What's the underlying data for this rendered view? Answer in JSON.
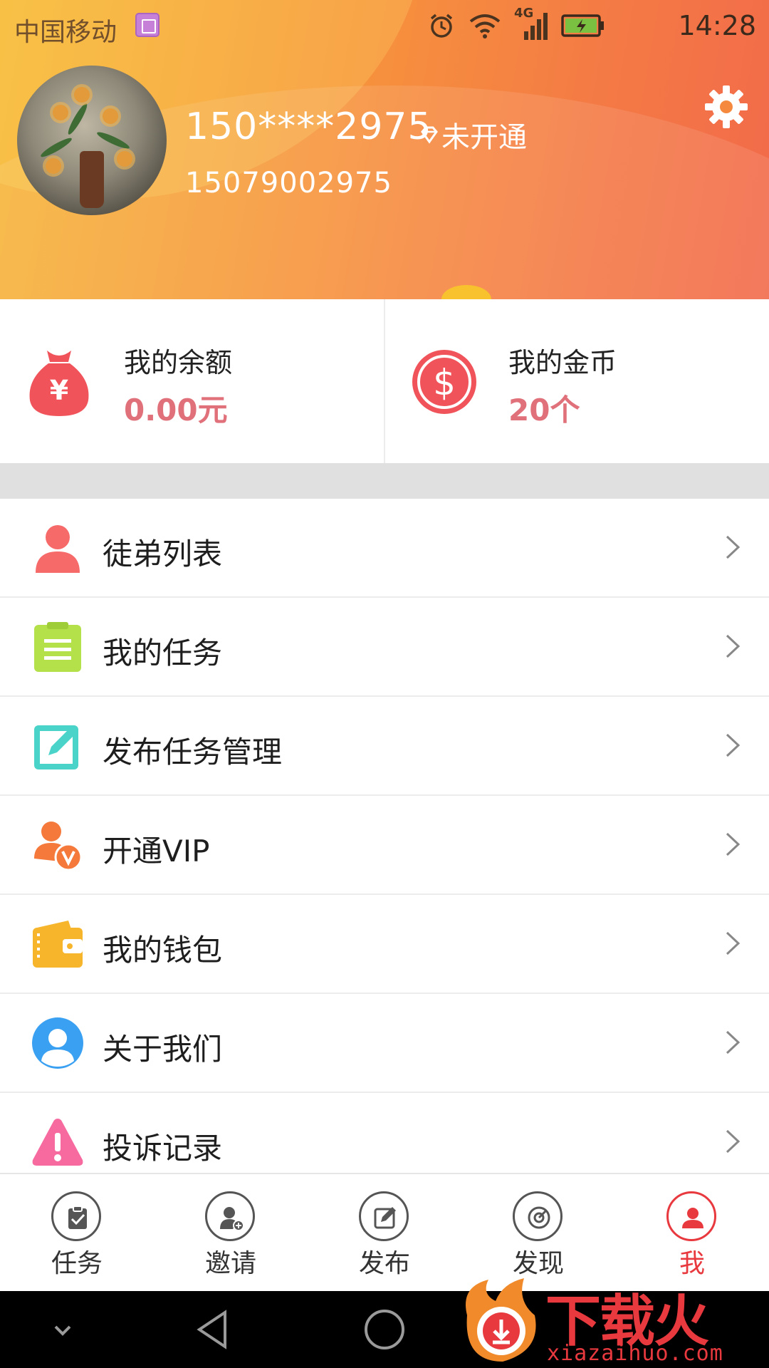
{
  "status_bar": {
    "carrier": "中国移动",
    "network": "4G",
    "time": "14:28"
  },
  "profile": {
    "display_name": "150****2975",
    "vip_status": "未开通",
    "phone": "15079002975"
  },
  "wallet": {
    "balance_label": "我的余额",
    "balance_value": "0.00元",
    "coins_label": "我的金币",
    "coins_value": "20个"
  },
  "menu": {
    "items": [
      {
        "label": "徒弟列表",
        "icon": "person-icon",
        "color": "#f76a6a"
      },
      {
        "label": "我的任务",
        "icon": "clipboard-icon",
        "color": "#b4e04a"
      },
      {
        "label": "发布任务管理",
        "icon": "edit-icon",
        "color": "#4ad4c9"
      },
      {
        "label": "开通VIP",
        "icon": "vip-user-icon",
        "color": "#f4793b"
      },
      {
        "label": "我的钱包",
        "icon": "wallet-icon",
        "color": "#f7b52c"
      },
      {
        "label": "关于我们",
        "icon": "user-circle-icon",
        "color": "#3aa0f2"
      },
      {
        "label": "投诉记录",
        "icon": "warning-icon",
        "color": "#f76aa0"
      }
    ]
  },
  "tabbar": {
    "tabs": [
      {
        "label": "任务",
        "icon": "task-icon"
      },
      {
        "label": "邀请",
        "icon": "invite-icon"
      },
      {
        "label": "发布",
        "icon": "publish-icon"
      },
      {
        "label": "发现",
        "icon": "discover-icon"
      },
      {
        "label": "我",
        "icon": "me-icon"
      }
    ],
    "active_index": 4,
    "active_color": "#e8393f"
  },
  "watermark": {
    "brand": "下载火",
    "url": "xiazaihuo.com"
  }
}
